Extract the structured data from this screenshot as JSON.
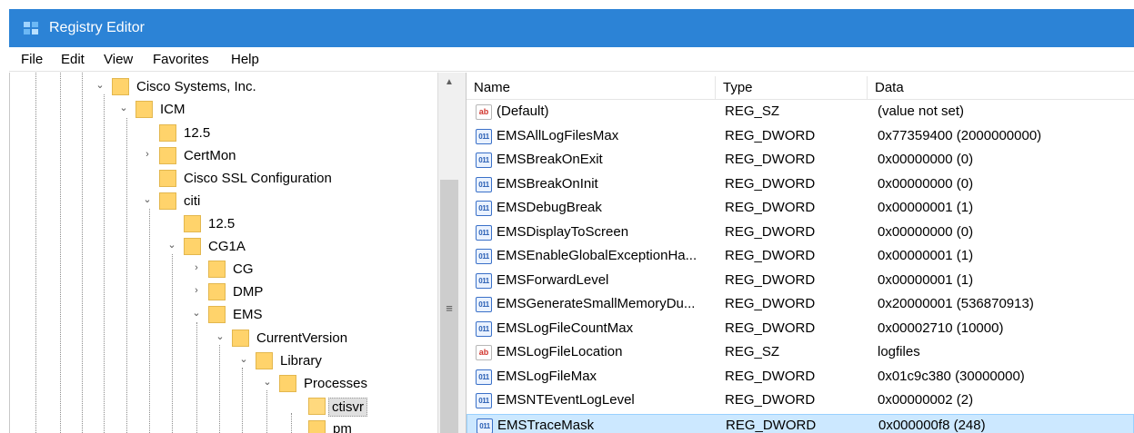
{
  "window": {
    "title": "Registry Editor",
    "icon": "registry-editor-icon",
    "accent_color": "#2c83d6"
  },
  "menu": {
    "items": [
      "File",
      "Edit",
      "View",
      "Favorites",
      "Help"
    ]
  },
  "tree": {
    "nodes": [
      {
        "label": "Cisco Systems, Inc.",
        "expander": "expanded"
      },
      {
        "label": "ICM",
        "expander": "expanded"
      },
      {
        "label": "12.5",
        "expander": "none"
      },
      {
        "label": "CertMon",
        "expander": "collapsed"
      },
      {
        "label": "Cisco SSL Configuration",
        "expander": "none"
      },
      {
        "label": "citi",
        "expander": "expanded"
      },
      {
        "label": "12.5",
        "expander": "none"
      },
      {
        "label": "CG1A",
        "expander": "expanded"
      },
      {
        "label": "CG",
        "expander": "collapsed"
      },
      {
        "label": "DMP",
        "expander": "collapsed"
      },
      {
        "label": "EMS",
        "expander": "expanded"
      },
      {
        "label": "CurrentVersion",
        "expander": "expanded"
      },
      {
        "label": "Library",
        "expander": "expanded"
      },
      {
        "label": "Processes",
        "expander": "expanded"
      },
      {
        "label": "ctisvr",
        "expander": "none",
        "selected": true
      },
      {
        "label": "pm",
        "expander": "none"
      }
    ]
  },
  "list": {
    "columns": [
      "Name",
      "Type",
      "Data"
    ],
    "rows": [
      {
        "icon": "string-value-icon",
        "name": "(Default)",
        "type": "REG_SZ",
        "data": "(value not set)"
      },
      {
        "icon": "dword-value-icon",
        "name": "EMSAllLogFilesMax",
        "type": "REG_DWORD",
        "data": "0x77359400 (2000000000)"
      },
      {
        "icon": "dword-value-icon",
        "name": "EMSBreakOnExit",
        "type": "REG_DWORD",
        "data": "0x00000000 (0)"
      },
      {
        "icon": "dword-value-icon",
        "name": "EMSBreakOnInit",
        "type": "REG_DWORD",
        "data": "0x00000000 (0)"
      },
      {
        "icon": "dword-value-icon",
        "name": "EMSDebugBreak",
        "type": "REG_DWORD",
        "data": "0x00000001 (1)"
      },
      {
        "icon": "dword-value-icon",
        "name": "EMSDisplayToScreen",
        "type": "REG_DWORD",
        "data": "0x00000000 (0)"
      },
      {
        "icon": "dword-value-icon",
        "name": "EMSEnableGlobalExceptionHa...",
        "type": "REG_DWORD",
        "data": "0x00000001 (1)"
      },
      {
        "icon": "dword-value-icon",
        "name": "EMSForwardLevel",
        "type": "REG_DWORD",
        "data": "0x00000001 (1)"
      },
      {
        "icon": "dword-value-icon",
        "name": "EMSGenerateSmallMemoryDu...",
        "type": "REG_DWORD",
        "data": "0x20000001 (536870913)"
      },
      {
        "icon": "dword-value-icon",
        "name": "EMSLogFileCountMax",
        "type": "REG_DWORD",
        "data": "0x00002710 (10000)"
      },
      {
        "icon": "string-value-icon",
        "name": "EMSLogFileLocation",
        "type": "REG_SZ",
        "data": "logfiles"
      },
      {
        "icon": "dword-value-icon",
        "name": "EMSLogFileMax",
        "type": "REG_DWORD",
        "data": "0x01c9c380 (30000000)"
      },
      {
        "icon": "dword-value-icon",
        "name": "EMSNTEventLogLevel",
        "type": "REG_DWORD",
        "data": "0x00000002 (2)"
      },
      {
        "icon": "dword-value-icon",
        "name": "EMSTraceMask",
        "type": "REG_DWORD",
        "data": "0x000000f8 (248)",
        "selected": true
      }
    ]
  }
}
